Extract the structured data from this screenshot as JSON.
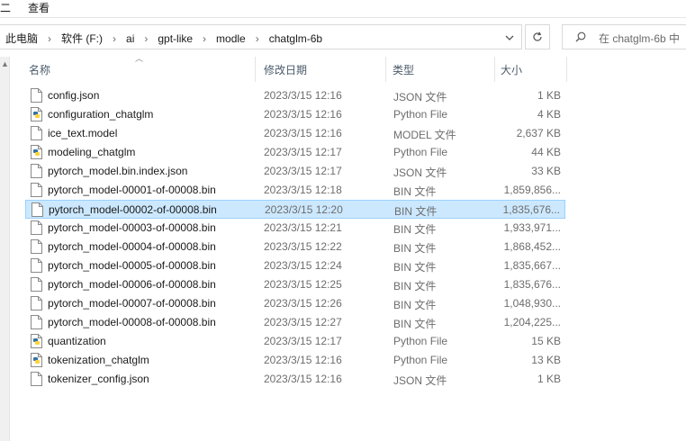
{
  "ribbon": {
    "left_stub": "二",
    "view_label": "查看"
  },
  "address": {
    "crumbs": [
      "此电脑",
      "软件 (F:)",
      "ai",
      "gpt-like",
      "modle",
      "chatglm-6b"
    ],
    "separator": "›"
  },
  "search": {
    "placeholder": "在 chatglm-6b 中"
  },
  "columns": {
    "name": "名称",
    "modified": "修改日期",
    "type": "类型",
    "size": "大小"
  },
  "files": [
    {
      "name": "config.json",
      "modified": "2023/3/15 12:16",
      "type": "JSON 文件",
      "size": "1 KB",
      "icon": "file-icon"
    },
    {
      "name": "configuration_chatglm",
      "modified": "2023/3/15 12:16",
      "type": "Python File",
      "size": "4 KB",
      "icon": "python-file-icon"
    },
    {
      "name": "ice_text.model",
      "modified": "2023/3/15 12:16",
      "type": "MODEL 文件",
      "size": "2,637 KB",
      "icon": "file-icon"
    },
    {
      "name": "modeling_chatglm",
      "modified": "2023/3/15 12:17",
      "type": "Python File",
      "size": "44 KB",
      "icon": "python-file-icon"
    },
    {
      "name": "pytorch_model.bin.index.json",
      "modified": "2023/3/15 12:17",
      "type": "JSON 文件",
      "size": "33 KB",
      "icon": "file-icon"
    },
    {
      "name": "pytorch_model-00001-of-00008.bin",
      "modified": "2023/3/15 12:18",
      "type": "BIN 文件",
      "size": "1,859,856...",
      "icon": "file-icon"
    },
    {
      "name": "pytorch_model-00002-of-00008.bin",
      "modified": "2023/3/15 12:20",
      "type": "BIN 文件",
      "size": "1,835,676...",
      "icon": "file-icon",
      "selected": true
    },
    {
      "name": "pytorch_model-00003-of-00008.bin",
      "modified": "2023/3/15 12:21",
      "type": "BIN 文件",
      "size": "1,933,971...",
      "icon": "file-icon"
    },
    {
      "name": "pytorch_model-00004-of-00008.bin",
      "modified": "2023/3/15 12:22",
      "type": "BIN 文件",
      "size": "1,868,452...",
      "icon": "file-icon"
    },
    {
      "name": "pytorch_model-00005-of-00008.bin",
      "modified": "2023/3/15 12:24",
      "type": "BIN 文件",
      "size": "1,835,667...",
      "icon": "file-icon"
    },
    {
      "name": "pytorch_model-00006-of-00008.bin",
      "modified": "2023/3/15 12:25",
      "type": "BIN 文件",
      "size": "1,835,676...",
      "icon": "file-icon"
    },
    {
      "name": "pytorch_model-00007-of-00008.bin",
      "modified": "2023/3/15 12:26",
      "type": "BIN 文件",
      "size": "1,048,930...",
      "icon": "file-icon"
    },
    {
      "name": "pytorch_model-00008-of-00008.bin",
      "modified": "2023/3/15 12:27",
      "type": "BIN 文件",
      "size": "1,204,225...",
      "icon": "file-icon"
    },
    {
      "name": "quantization",
      "modified": "2023/3/15 12:17",
      "type": "Python File",
      "size": "15 KB",
      "icon": "python-file-icon"
    },
    {
      "name": "tokenization_chatglm",
      "modified": "2023/3/15 12:16",
      "type": "Python File",
      "size": "13 KB",
      "icon": "python-file-icon"
    },
    {
      "name": "tokenizer_config.json",
      "modified": "2023/3/15 12:16",
      "type": "JSON 文件",
      "size": "1 KB",
      "icon": "file-icon"
    }
  ],
  "colors": {
    "selection_bg": "#cce8ff",
    "selection_border": "#99d1ff",
    "python_blue": "#3572a5",
    "python_yellow": "#ffd43b"
  }
}
